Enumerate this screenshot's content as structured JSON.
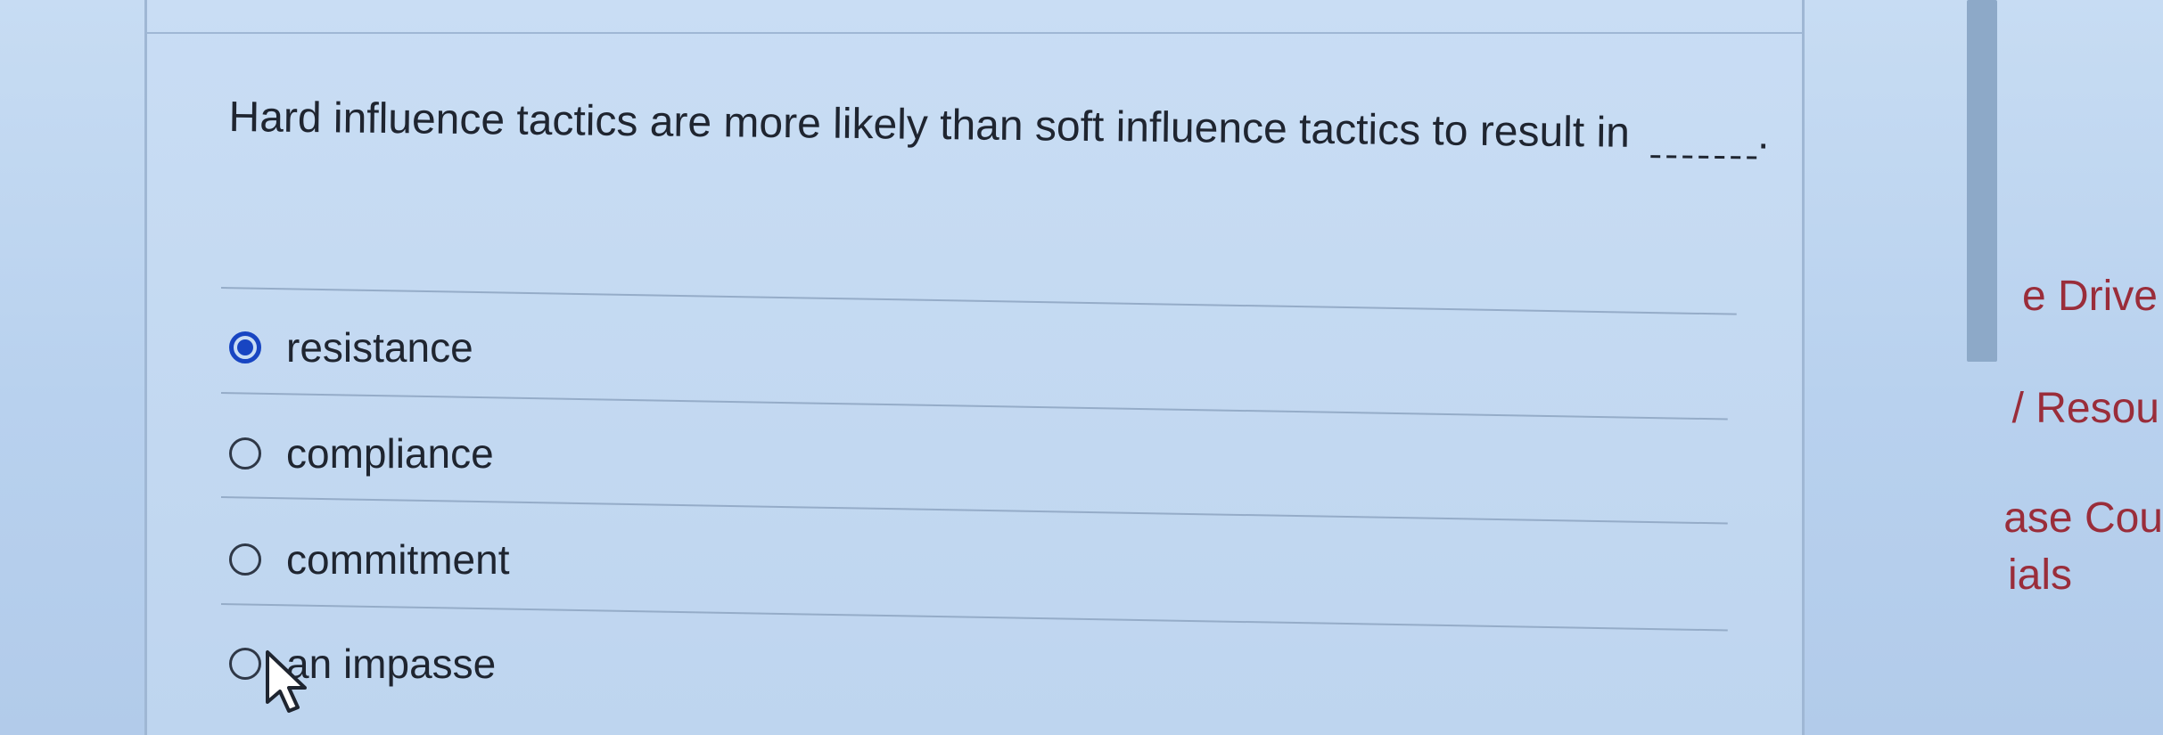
{
  "question": {
    "text": "Hard influence tactics are more likely than soft influence tactics to result in"
  },
  "answer": {
    "period": "."
  },
  "options": [
    {
      "label": "resistance",
      "selected": true
    },
    {
      "label": "compliance",
      "selected": false
    },
    {
      "label": "commitment",
      "selected": false
    },
    {
      "label": "an impasse",
      "selected": false
    }
  ],
  "sidebar": {
    "links": [
      {
        "label": "e Drive"
      },
      {
        "label": "/ Resou"
      },
      {
        "label": "ase Cou"
      },
      {
        "label": "ials"
      }
    ]
  },
  "colors": {
    "background": "#b9d2ee",
    "panel": "#c9ddf4",
    "accent": "#1845c2",
    "link": "#9a2d3a",
    "text": "#1f2530"
  },
  "icons": {
    "selected_radio": "radio-checked-icon",
    "unselected_radio": "radio-unchecked-icon",
    "cursor": "mouse-pointer-icon"
  }
}
